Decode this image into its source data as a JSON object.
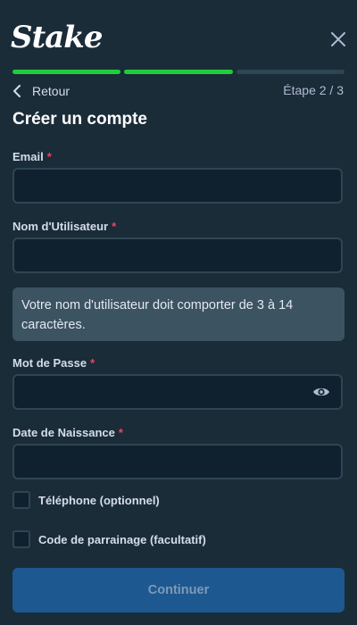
{
  "brand": {
    "logo_text": "Stake"
  },
  "header": {
    "close_icon": "close-icon"
  },
  "progress": {
    "steps_total": 3,
    "steps_completed": 2,
    "active_color": "#1fcf3a",
    "inactive_color": "#2f4553"
  },
  "nav": {
    "back_label": "Retour",
    "step_label": "Étape 2 / 3"
  },
  "form": {
    "title": "Créer un compte",
    "required_marker": "*",
    "email": {
      "label": "Email",
      "value": "",
      "placeholder": ""
    },
    "username": {
      "label": "Nom d'Utilisateur",
      "value": "",
      "placeholder": ""
    },
    "username_hint": "Votre nom d'utilisateur doit comporter de 3 à 14 caractères.",
    "password": {
      "label": "Mot de Passe",
      "value": "",
      "placeholder": ""
    },
    "birthdate": {
      "label": "Date de Naissance",
      "value": "",
      "placeholder": ""
    },
    "phone_checkbox": {
      "label": "Téléphone (optionnel)",
      "checked": false
    },
    "referral_checkbox": {
      "label": "Code de parrainage (facultatif)",
      "checked": false
    },
    "submit_label": "Continuer"
  },
  "colors": {
    "background": "#1a2c38",
    "input_background": "#0f212e",
    "button": "#1e5890",
    "required": "#ed4163"
  }
}
